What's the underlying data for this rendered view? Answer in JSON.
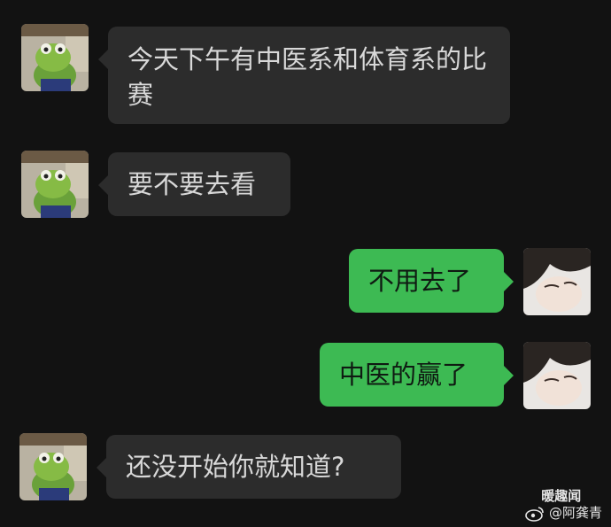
{
  "messages": [
    {
      "side": "left",
      "text": "今天下午有中医系和体育系的比赛",
      "avatar": "frog-avatar"
    },
    {
      "side": "left",
      "text": "要不要去看",
      "avatar": "frog-avatar"
    },
    {
      "side": "right",
      "text": "不用去了",
      "avatar": "boy-avatar"
    },
    {
      "side": "right",
      "text": "中医的赢了",
      "avatar": "boy-avatar"
    },
    {
      "side": "left",
      "text": "还没开始你就知道?",
      "avatar": "frog-avatar"
    }
  ],
  "watermark": {
    "line1": "暖趣闻",
    "line2": "@阿龚青"
  },
  "colors": {
    "background": "#121212",
    "left_bubble": "#2c2c2c",
    "right_bubble": "#3dba53"
  }
}
